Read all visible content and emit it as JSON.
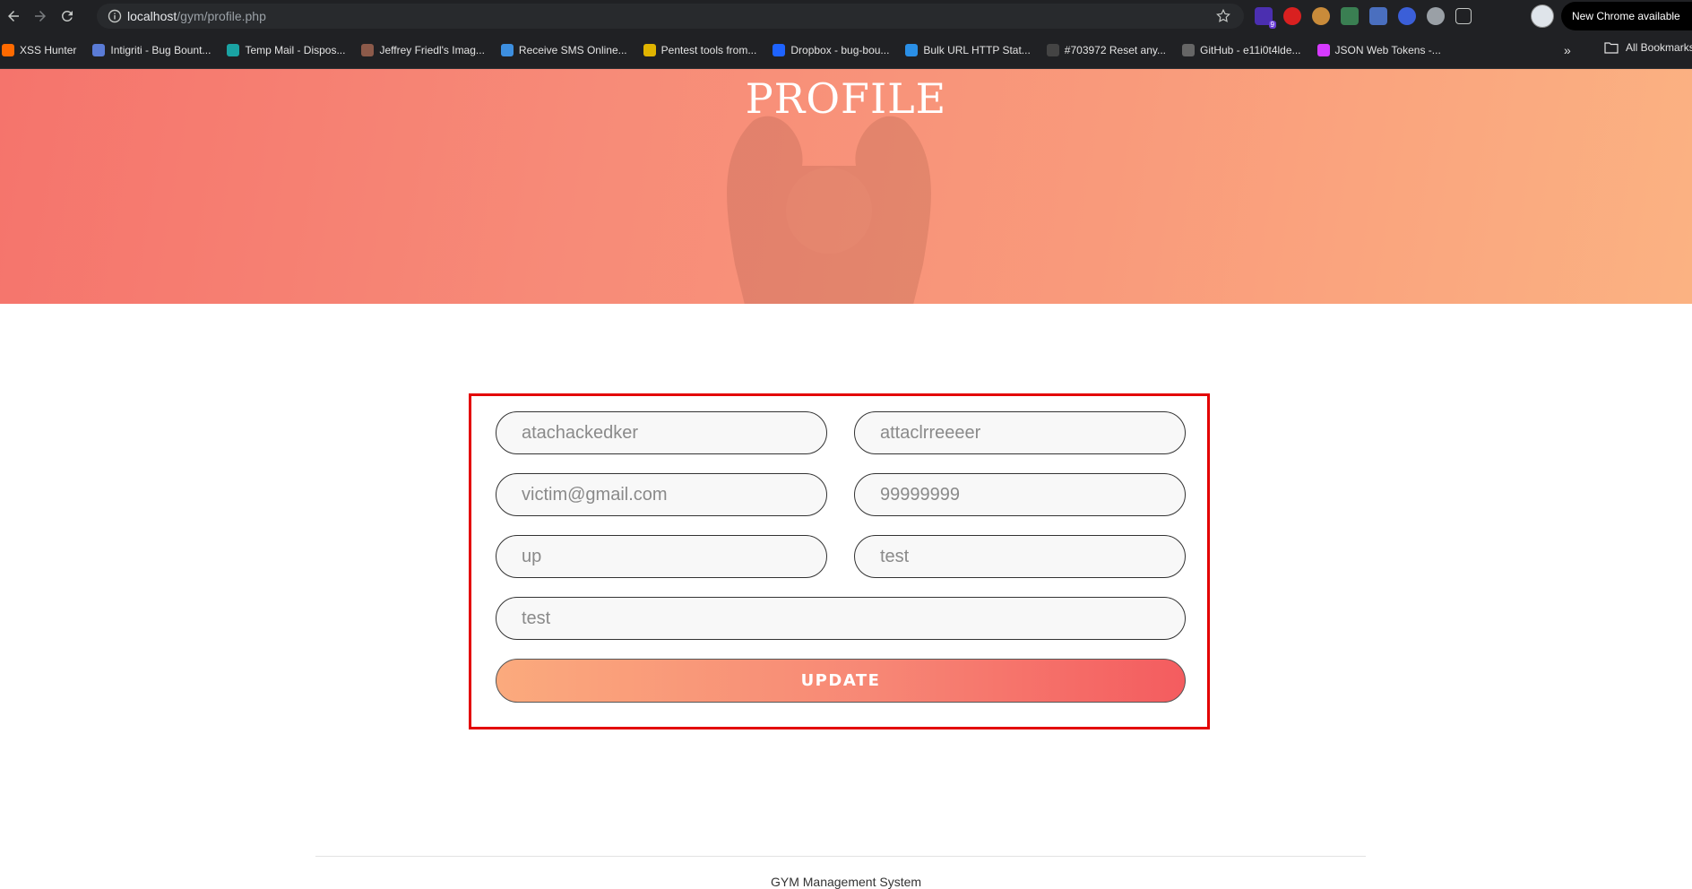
{
  "browser": {
    "url_host": "localhost",
    "url_path": "/gym/profile.php",
    "update_chip": "New Chrome available",
    "extension_badge": "9",
    "bookmarks": [
      {
        "label": "XSS Hunter",
        "icon": "flame-icon",
        "color": "#ff6a00"
      },
      {
        "label": "Intigriti - Bug Bount...",
        "icon": "intigriti-icon",
        "color": "#5a7bd6"
      },
      {
        "label": "Temp Mail - Dispos...",
        "icon": "tempmail-icon",
        "color": "#1aa3a3"
      },
      {
        "label": "Jeffrey Friedl's Imag...",
        "icon": "image-icon",
        "color": "#8c5a4a"
      },
      {
        "label": "Receive SMS Online...",
        "icon": "chat-icon",
        "color": "#3d8fe0"
      },
      {
        "label": "Pentest tools from...",
        "icon": "pentest-icon",
        "color": "#e0b400"
      },
      {
        "label": "Dropbox - bug-bou...",
        "icon": "dropbox-icon",
        "color": "#1e63ff"
      },
      {
        "label": "Bulk URL HTTP Stat...",
        "icon": "bulk-url-icon",
        "color": "#2a8fe6"
      },
      {
        "label": "#703972 Reset any...",
        "icon": "hackerone-icon",
        "color": "#444444"
      },
      {
        "label": "GitHub - e11i0t4lde...",
        "icon": "github-icon",
        "color": "#666666"
      },
      {
        "label": "JSON Web Tokens -...",
        "icon": "jwt-icon",
        "color": "#d63aff"
      }
    ],
    "all_bookmarks": "All Bookmarks"
  },
  "hero": {
    "title": "PROFILE"
  },
  "form": {
    "first_name": "atachackedker",
    "last_name": "attaclrreeeer",
    "email": "victim@gmail.com",
    "phone": "99999999",
    "field_5": "up",
    "field_6": "test",
    "field_7": "test",
    "update_label": "UPDATE"
  },
  "footer": {
    "text": "GYM Management System"
  },
  "colors": {
    "highlight_box": "#e30000",
    "hero_gradient_start": "#f5746c",
    "hero_gradient_end": "#fbb282",
    "button_gradient_start": "#fbaa7d",
    "button_gradient_end": "#f45c5f"
  }
}
